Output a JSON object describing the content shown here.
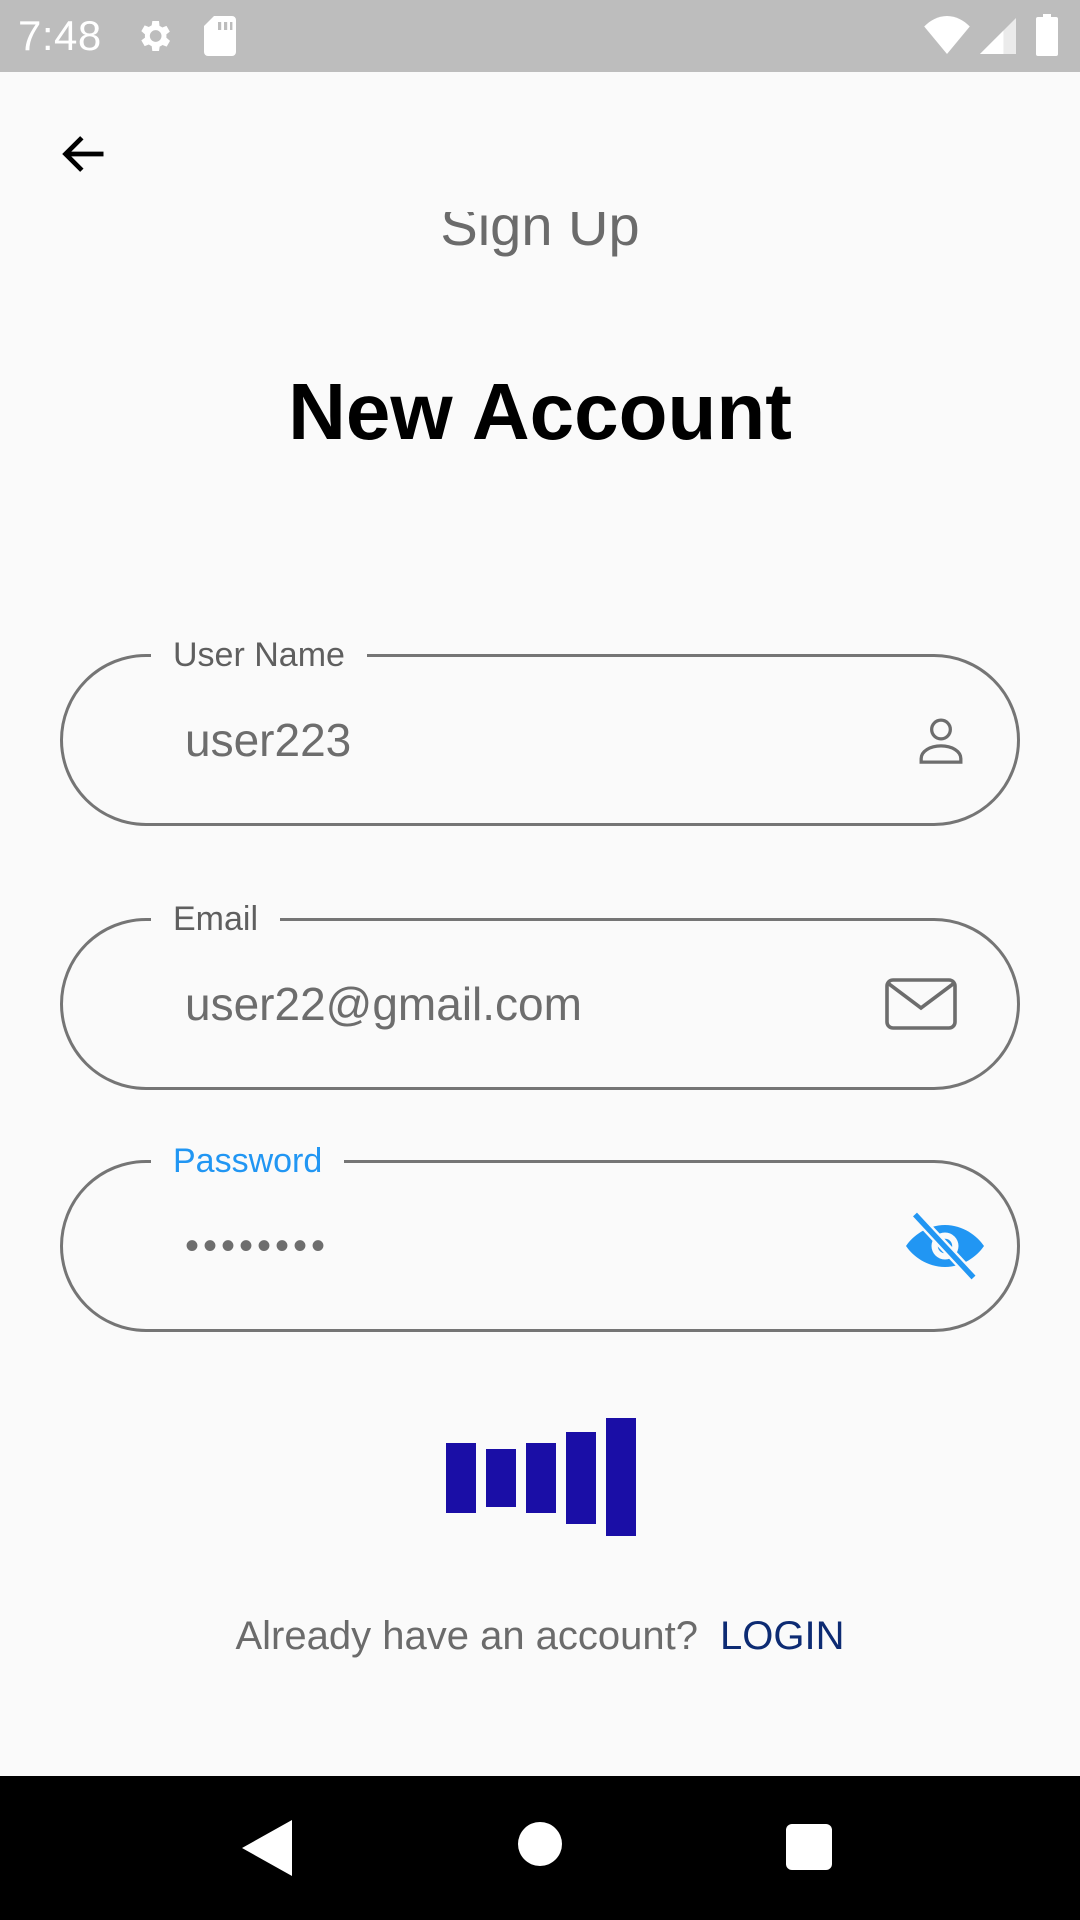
{
  "status_bar": {
    "time": "7:48",
    "icons": [
      "gear-icon",
      "sd-card-icon",
      "wifi-icon",
      "signal-icon",
      "battery-icon"
    ]
  },
  "header": {
    "back_icon": "arrow-left-icon",
    "peek_title": "Sign Up",
    "title": "New Account"
  },
  "form": {
    "username": {
      "label": "User Name",
      "value": "user223",
      "icon": "person-icon"
    },
    "email": {
      "label": "Email",
      "value": "user22@gmail.com",
      "icon": "mail-icon"
    },
    "password": {
      "label": "Password",
      "value": "••••••••",
      "icon": "eye-off-icon",
      "focused": true
    }
  },
  "strength_meter": {
    "icon": "password-strength-bars-icon",
    "filled_bars": 5,
    "total_bars": 5
  },
  "footer": {
    "prompt": "Already have an account?",
    "login_label": "LOGIN"
  },
  "nav_bar": {
    "icons": [
      "back-triangle-icon",
      "home-circle-icon",
      "recents-square-icon"
    ]
  },
  "colors": {
    "background": "#fafafa",
    "focus_accent": "#2196f3",
    "strength_bar": "#1a0ea6",
    "login_link": "#0d2b73",
    "status_bar": "#bdbdbd"
  }
}
